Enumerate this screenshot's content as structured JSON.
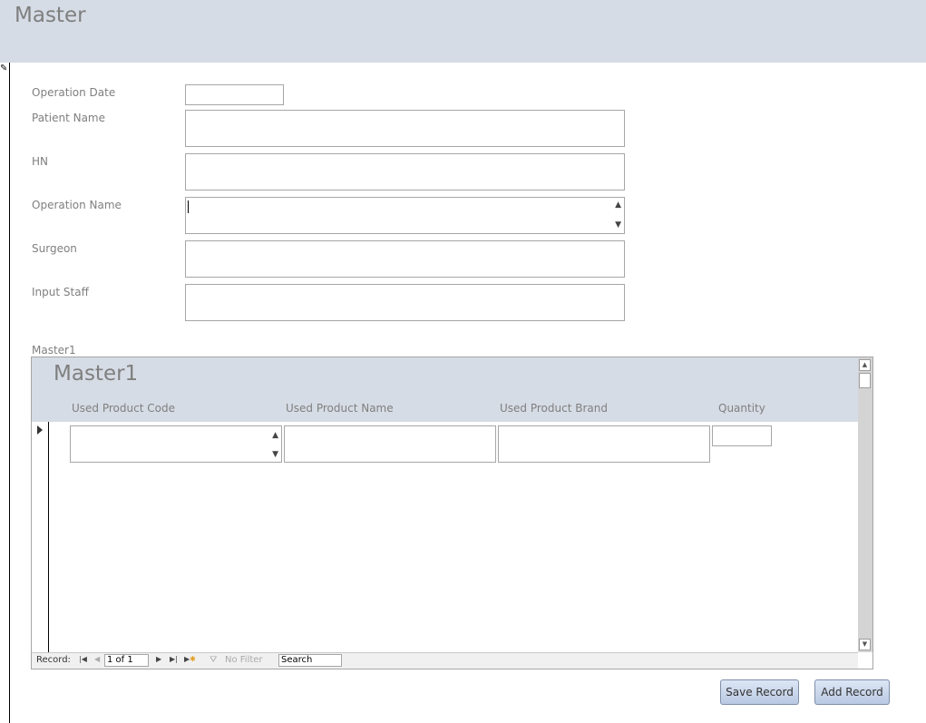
{
  "form": {
    "title": "Master",
    "fields": {
      "operation_date": {
        "label": "Operation Date",
        "value": ""
      },
      "patient_name": {
        "label": "Patient Name",
        "value": ""
      },
      "hn": {
        "label": "HN",
        "value": ""
      },
      "operation_name": {
        "label": "Operation Name",
        "value": ""
      },
      "surgeon": {
        "label": "Surgeon",
        "value": ""
      },
      "input_staff": {
        "label": "Input Staff",
        "value": ""
      }
    }
  },
  "subform": {
    "caption": "Master1",
    "title": "Master1",
    "columns": [
      "Used Product Code",
      "Used Product Name",
      "Used Product Brand",
      "Quantity"
    ],
    "row": {
      "code": "",
      "name": "",
      "brand": "",
      "quantity": ""
    },
    "nav": {
      "record_label": "Record:",
      "current": "1 of 1",
      "filter_label": "No Filter",
      "search_label": "Search"
    }
  },
  "buttons": {
    "save": "Save Record",
    "add": "Add Record"
  }
}
